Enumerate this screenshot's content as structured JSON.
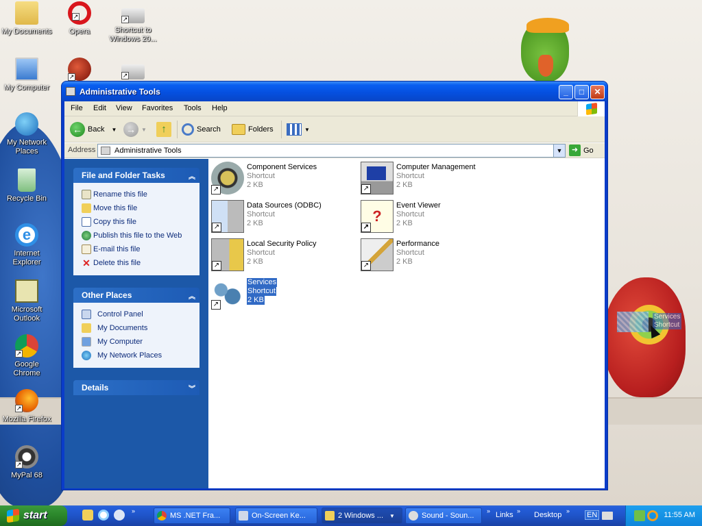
{
  "desktop": {
    "icons": [
      {
        "label": "My Documents"
      },
      {
        "label": "Opera"
      },
      {
        "label": "Shortcut to Windows 20..."
      },
      {
        "label": "My Computer"
      },
      {
        "label": "My Network Places"
      },
      {
        "label": "Recycle Bin"
      },
      {
        "label": "Internet Explorer"
      },
      {
        "label": "Microsoft Outlook"
      },
      {
        "label": "Google Chrome"
      },
      {
        "label": "Mozilla Firefox"
      },
      {
        "label": "MyPal 68"
      }
    ]
  },
  "window": {
    "title": "Administrative Tools",
    "menu": [
      "File",
      "Edit",
      "View",
      "Favorites",
      "Tools",
      "Help"
    ],
    "toolbar": {
      "back": "Back",
      "search": "Search",
      "folders": "Folders"
    },
    "address": {
      "label": "Address",
      "value": "Administrative Tools",
      "go": "Go"
    },
    "taskpane": {
      "file_tasks": {
        "title": "File and Folder Tasks",
        "items": [
          "Rename this file",
          "Move this file",
          "Copy this file",
          "Publish this file to the Web",
          "E-mail this file",
          "Delete this file"
        ]
      },
      "other_places": {
        "title": "Other Places",
        "items": [
          "Control Panel",
          "My Documents",
          "My Computer",
          "My Network Places"
        ]
      },
      "details": {
        "title": "Details"
      }
    },
    "files": [
      {
        "name": "Component Services",
        "type": "Shortcut",
        "size": "2 KB"
      },
      {
        "name": "Computer Management",
        "type": "Shortcut",
        "size": "2 KB"
      },
      {
        "name": "Data Sources (ODBC)",
        "type": "Shortcut",
        "size": "2 KB"
      },
      {
        "name": "Event Viewer",
        "type": "Shortcut",
        "size": "2 KB"
      },
      {
        "name": "Local Security Policy",
        "type": "Shortcut",
        "size": "2 KB"
      },
      {
        "name": "Performance",
        "type": "Shortcut",
        "size": "2 KB"
      },
      {
        "name": "Services",
        "type": "Shortcut",
        "size": "2 KB",
        "selected": true
      }
    ]
  },
  "drag_ghost": {
    "name": "Services",
    "type": "Shortcut"
  },
  "taskbar": {
    "start": "start",
    "tasks": [
      "MS .NET Fra...",
      "On-Screen Ke...",
      "2 Windows ...",
      "Sound - Soun..."
    ],
    "links": "Links",
    "desktop": "Desktop",
    "lang": "EN",
    "clock": "11:55 AM"
  },
  "colors": {
    "selection": "#316ac5",
    "title_blue": "#0a5ff0",
    "taskbar": "#245edb",
    "start_green": "#2d8a2d"
  }
}
